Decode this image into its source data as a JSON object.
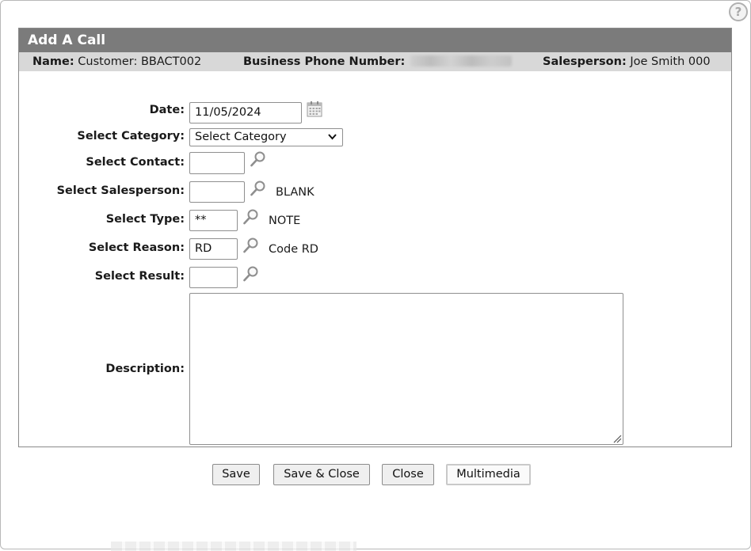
{
  "dialog": {
    "title": "Add A Call",
    "help_icon": "question-circle-icon"
  },
  "info_bar": {
    "name_label": "Name:",
    "name_value": "Customer: BBACT002",
    "phone_label": "Business Phone Number:",
    "salesperson_label": "Salesperson:",
    "salesperson_value": "Joe Smith 000"
  },
  "form": {
    "date": {
      "label": "Date:",
      "value": "11/05/2024",
      "icon": "calendar-icon"
    },
    "category": {
      "label": "Select Category:",
      "selected": "Select Category"
    },
    "contact": {
      "label": "Select Contact:",
      "value": "",
      "icon": "magnifier-icon"
    },
    "salesperson": {
      "label": "Select Salesperson:",
      "value": "",
      "icon": "magnifier-icon",
      "lookup_text": "BLANK"
    },
    "type": {
      "label": "Select Type:",
      "value": "**",
      "icon": "magnifier-icon",
      "lookup_text": "NOTE"
    },
    "reason": {
      "label": "Select Reason:",
      "value": "RD",
      "icon": "magnifier-icon",
      "lookup_text": "Code RD"
    },
    "result": {
      "label": "Select Result:",
      "value": "",
      "icon": "magnifier-icon"
    },
    "description": {
      "label": "Description:",
      "value": ""
    }
  },
  "buttons": {
    "save": "Save",
    "save_close": "Save & Close",
    "close": "Close",
    "multimedia": "Multimedia"
  },
  "colors": {
    "title_bar": "#7b7b7b",
    "info_bar": "#d8d8d8",
    "panel_border": "#8a8a8a"
  }
}
